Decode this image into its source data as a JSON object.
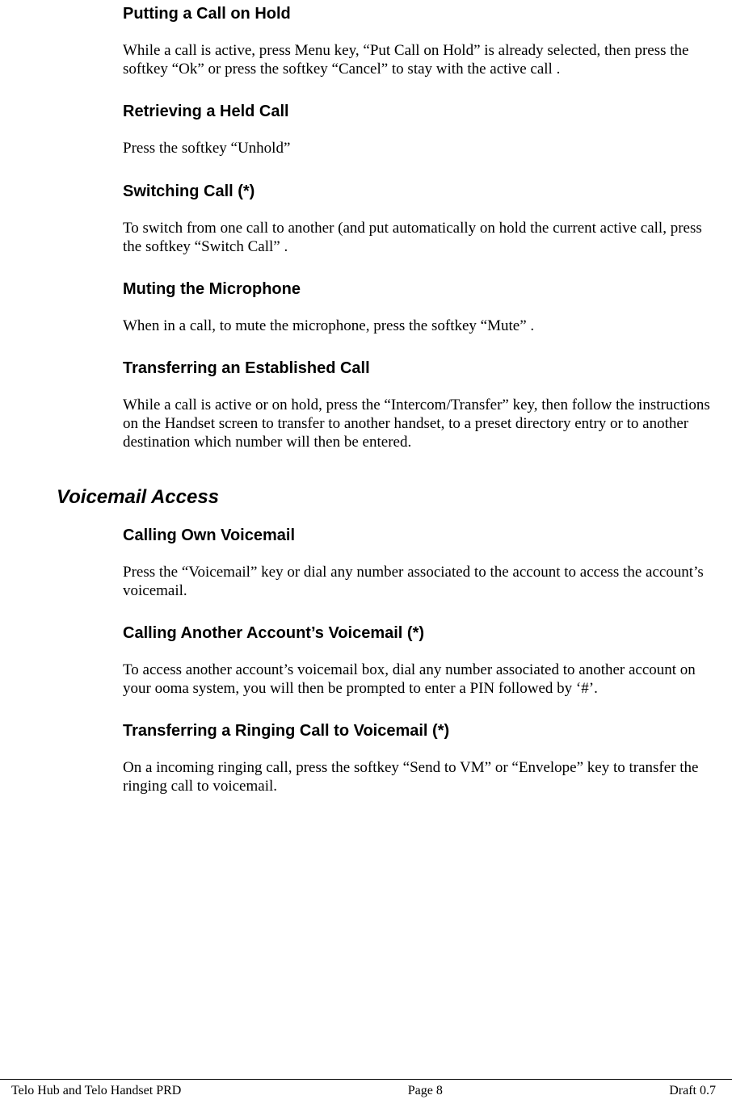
{
  "sections": [
    {
      "heading": "Putting a Call on Hold",
      "body": "While a call is active, press Menu key, “Put Call on Hold” is already selected, then press the softkey “Ok” or press the softkey “Cancel” to stay with the active call ."
    },
    {
      "heading": "Retrieving a Held Call",
      "body": "Press the softkey “Unhold”"
    },
    {
      "heading": "Switching Call (*)",
      "body": "To switch from one call to another (and put automatically on hold the current active call, press the softkey “Switch Call” ."
    },
    {
      "heading": "Muting the Microphone",
      "body": "When in a call, to mute the microphone, press the softkey “Mute” ."
    },
    {
      "heading": "Transferring an Established Call",
      "body": "While a call is active or on hold, press the “Intercom/Transfer” key, then follow the instructions on the Handset screen to transfer to another handset, to a preset directory entry or to another destination which number will then be entered."
    }
  ],
  "section_title": "Voicemail Access",
  "voicemail_sections": [
    {
      "heading": "Calling Own Voicemail",
      "body": "Press the “Voicemail” key or dial any number associated to the account to access the account’s voicemail."
    },
    {
      "heading": "Calling Another Account’s Voicemail (*)",
      "body": "To access another account’s voicemail box, dial any number associated to another account on your ooma system, you will then be prompted to enter a PIN followed by ‘#’."
    },
    {
      "heading": "Transferring a Ringing Call to Voicemail (*)",
      "body": "On a incoming ringing call, press the softkey “Send to VM” or “Envelope” key to transfer the ringing call to voicemail."
    }
  ],
  "footer": {
    "left": "Telo Hub and Telo Handset  PRD",
    "center": "Page 8",
    "right": "Draft 0.7"
  }
}
